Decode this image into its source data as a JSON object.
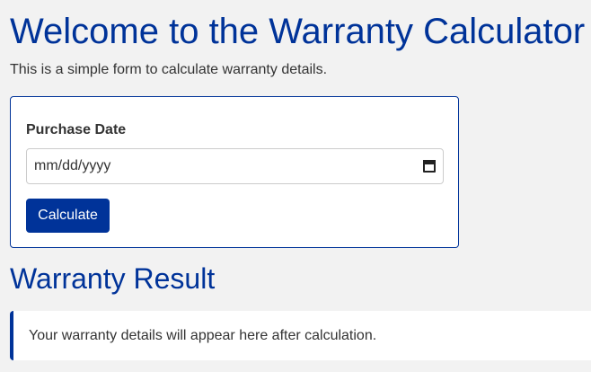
{
  "page": {
    "title": "Welcome to the Warranty Calculator",
    "intro": "This is a simple form to calculate warranty details."
  },
  "form": {
    "purchase_date_label": "Purchase Date",
    "purchase_date_placeholder": "mm/dd/yyyy",
    "calculate_label": "Calculate"
  },
  "result": {
    "heading": "Warranty Result",
    "message": "Your warranty details will appear here after calculation."
  },
  "icons": {
    "date_picker": "calendar-icon"
  },
  "colors": {
    "accent": "#003399",
    "background": "#f2f2f2",
    "card": "#ffffff",
    "text": "#333333"
  }
}
